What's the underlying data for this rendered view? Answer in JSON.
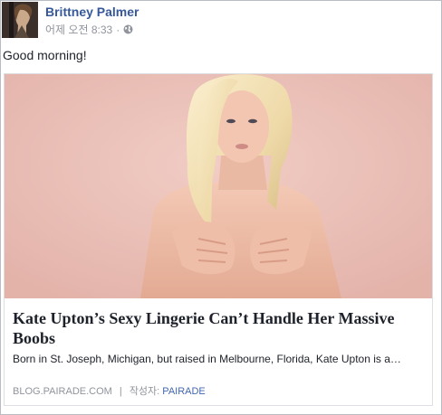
{
  "post": {
    "author": "Brittney Palmer",
    "timestamp": "어제 오전 8:33",
    "separator": "·",
    "privacy_icon": "globe-icon",
    "text": "Good morning!"
  },
  "link_card": {
    "title": "Kate Upton’s Sexy Lingerie Can’t Handle Her Massive Boobs",
    "description": "Born in St. Joseph, Michigan, but raised in Melbourne, Florida, Kate Upton is a…",
    "domain": "BLOG.PAIRADE.COM",
    "divider": "|",
    "author_prefix": "작성자:",
    "author_name": "PAIRADE"
  },
  "colors": {
    "link_blue": "#365899",
    "meta_gray": "#90949c",
    "text_dark": "#1d2129",
    "card_border": "#dddfe2",
    "image_background": "#ecc4bc"
  }
}
